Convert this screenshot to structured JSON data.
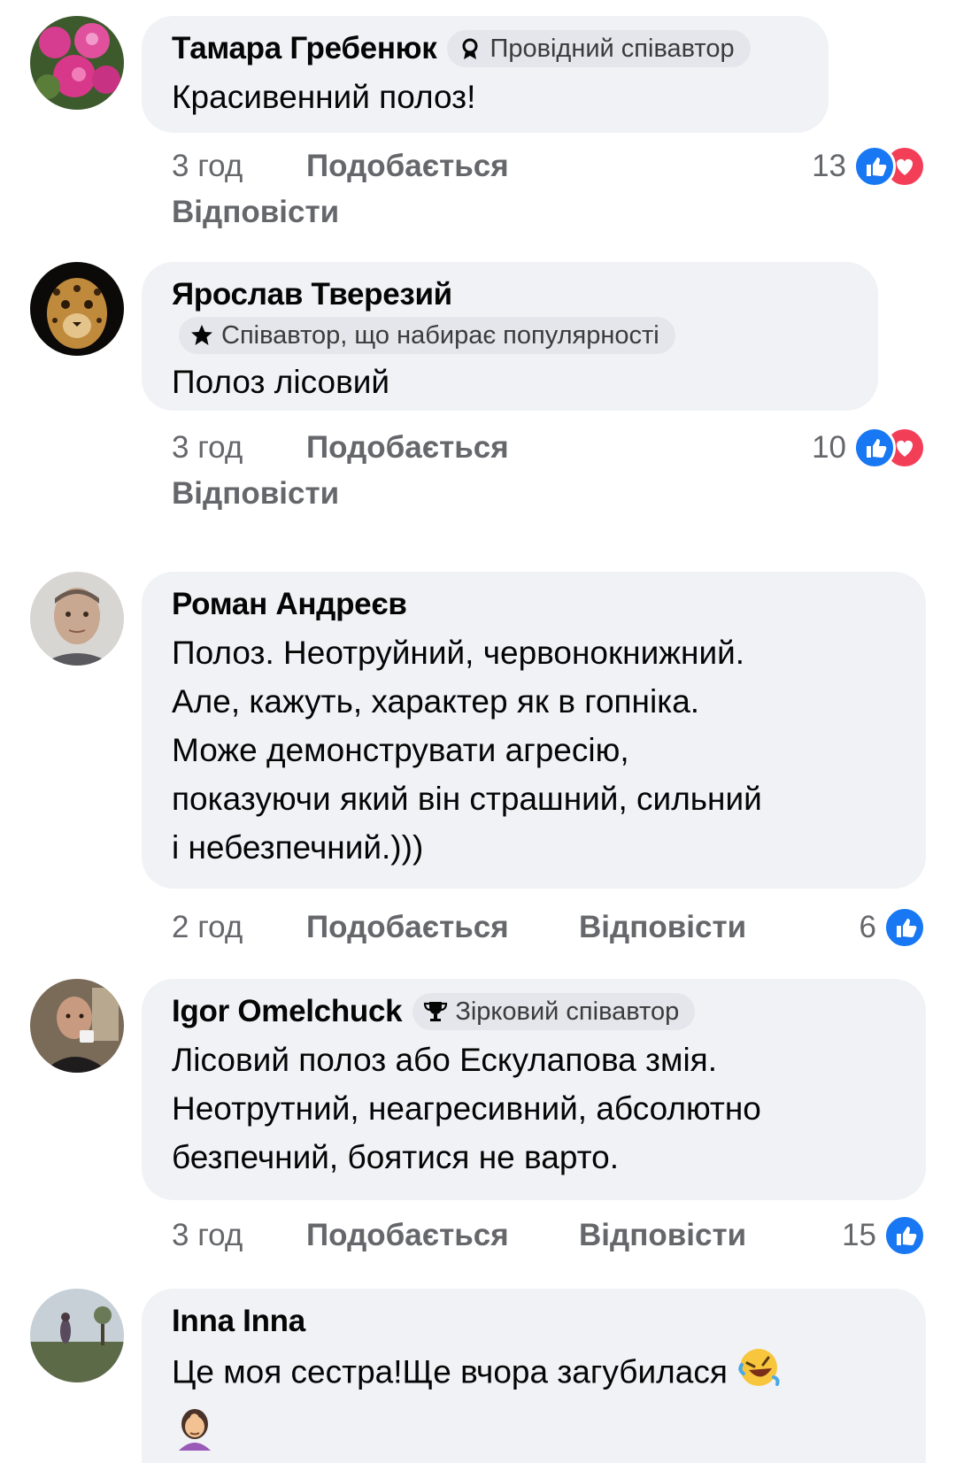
{
  "comments": [
    {
      "name": "Тамара Гребенюк",
      "badge": "Провідний співавтор",
      "badge_icon": "award-ribbon-icon",
      "text": [
        "Красивенний полоз!"
      ],
      "time": "3 год",
      "like_label": "Подобається",
      "reply_label": "Відповісти",
      "reaction_count": "13",
      "reactions": [
        "like",
        "love"
      ]
    },
    {
      "name": "Ярослав Тверезий",
      "badge": "Співавтор, що набирає популярності",
      "badge_icon": "star-icon",
      "text": [
        "Полоз лісовий"
      ],
      "time": "3 год",
      "like_label": "Подобається",
      "reply_label": "Відповісти",
      "reaction_count": "10",
      "reactions": [
        "like",
        "love"
      ]
    },
    {
      "name": "Роман Андреєв",
      "text": [
        "Полоз. Неотруйний, червонокнижний.",
        "Але, кажуть, характер як в гопніка.",
        "Може демонструвати агресію,",
        "показуючи який він страшний, сильний",
        "і небезпечний.)))"
      ],
      "time": "2 год",
      "like_label": "Подобається",
      "reply_label": "Відповісти",
      "reaction_count": "6",
      "reactions": [
        "like"
      ]
    },
    {
      "name": "Igor Omelchuck",
      "badge": "Зірковий співавтор",
      "badge_icon": "trophy-icon",
      "text": [
        "Лісовий полоз або Ескулапова змія.",
        "Неотрутний, неагресивний, абсолютно",
        "безпечний, боятися не варто."
      ],
      "time": "3 год",
      "like_label": "Подобається",
      "reply_label": "Відповісти",
      "reaction_count": "15",
      "reactions": [
        "like"
      ]
    },
    {
      "name": "Inna Inna",
      "text": [
        "Це моя сестра!Ще вчора загубилася"
      ],
      "emojis": [
        "rolling-laughing-emoji",
        "woman-facepalming-emoji"
      ]
    }
  ],
  "colors": {
    "bubble": "#f0f2f5",
    "badge": "#e4e6eb",
    "meta_text": "#65676b",
    "like_blue": "#1877f2",
    "love_red": "#f33e58"
  }
}
